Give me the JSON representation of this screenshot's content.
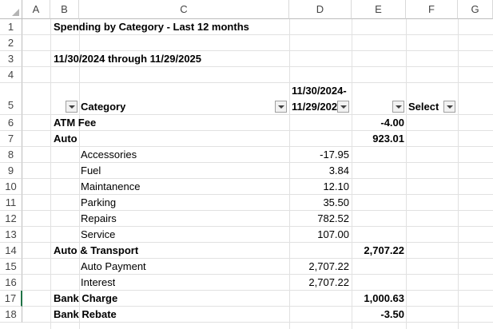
{
  "columns": [
    "A",
    "B",
    "C",
    "D",
    "E",
    "F",
    "G"
  ],
  "rows": [
    "1",
    "2",
    "3",
    "4",
    "5",
    "6",
    "7",
    "8",
    "9",
    "10",
    "11",
    "12",
    "13",
    "14",
    "15",
    "16",
    "17",
    "18"
  ],
  "title": "Spending by Category - Last 12 months",
  "date_range": "11/30/2024 through 11/29/2025",
  "header": {
    "category": "Category",
    "period_line1": "11/30/2024-",
    "period_line2": "11/29/202",
    "select": "Select"
  },
  "entries": [
    {
      "label": "ATM Fee",
      "level": 1,
      "total": "-4.00"
    },
    {
      "label": "Auto",
      "level": 1,
      "total": "923.01"
    },
    {
      "label": "Accessories",
      "level": 2,
      "amount": "-17.95"
    },
    {
      "label": "Fuel",
      "level": 2,
      "amount": "3.84"
    },
    {
      "label": "Maintanence",
      "level": 2,
      "amount": "12.10"
    },
    {
      "label": "Parking",
      "level": 2,
      "amount": "35.50"
    },
    {
      "label": "Repairs",
      "level": 2,
      "amount": "782.52"
    },
    {
      "label": "Service",
      "level": 2,
      "amount": "107.00"
    },
    {
      "label": "Auto & Transport",
      "level": 1,
      "total": "2,707.22"
    },
    {
      "label": "Auto Payment",
      "level": 2,
      "amount": "2,707.22"
    },
    {
      "label": "Interest",
      "level": 2,
      "amount": "2,707.22"
    },
    {
      "label": "Bank Charge",
      "level": 1,
      "total": "1,000.63"
    },
    {
      "label": "Bank Rebate",
      "level": 1,
      "total": "-3.50"
    }
  ],
  "accent_color": "#217346"
}
